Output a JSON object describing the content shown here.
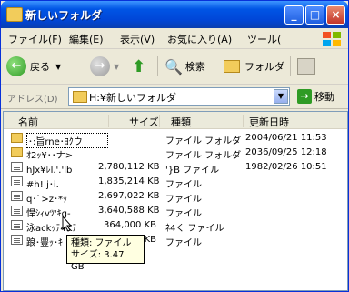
{
  "window": {
    "title": "新しいフォルダ"
  },
  "menu": [
    "ファイル(F)",
    "編集(E)",
    "表示(V)",
    "お気に入り(A)",
    "ツール("
  ],
  "toolbar": {
    "back": "戻る",
    "search": "検索",
    "folders": "フォルダ"
  },
  "address": {
    "label": "アドレス(D)",
    "value": "H:¥新しいフォルダ",
    "go": "移動"
  },
  "columns": {
    "name": "名前",
    "size": "サイズ",
    "type": "種類",
    "date": "更新日時"
  },
  "files": [
    {
      "icon": "folder-icon",
      "name": "･:旨rne･ﾖｸウ",
      "size": "",
      "type": "ファイル フォルダ",
      "date": "2004/06/21 11:53"
    },
    {
      "icon": "folder-icon",
      "name": "ｵ2ｯ¥･･ナ>",
      "size": "",
      "type": "ファイル フォルダ",
      "date": "2036/09/25 12:18"
    },
    {
      "icon": "file-icon",
      "name": "hJx¥ﾚl.'.'lb",
      "size": "2,780,112 KB",
      "type": "'}B ファイル",
      "date": "1982/02/26 10:51"
    },
    {
      "icon": "file-icon",
      "name": "#h!|j･i.",
      "size": "1,835,214 KB",
      "type": "ファイル",
      "date": ""
    },
    {
      "icon": "file-icon",
      "name": "q･`>z･*ｯ",
      "size": "2,697,022 KB",
      "type": "ファイル",
      "date": ""
    },
    {
      "icon": "file-icon",
      "name": "悍ｼｨvﾂ'ｷg-",
      "size": "3,640,588 KB",
      "type": "ファイル",
      "date": ""
    },
    {
      "icon": "file-icon",
      "name": "泳ackｯﾃ4Kﾃ",
      "size": "364,000 KB",
      "type": "ﾈ4く ファイル",
      "date": ""
    },
    {
      "icon": "file-icon",
      "name": "踉･豐ｯ･ｷ",
      "size": "KB",
      "type": "ファイル",
      "date": ""
    }
  ],
  "tooltip": {
    "line1": "種類: ファイル",
    "line2": "サイズ: 3.47 GB"
  }
}
